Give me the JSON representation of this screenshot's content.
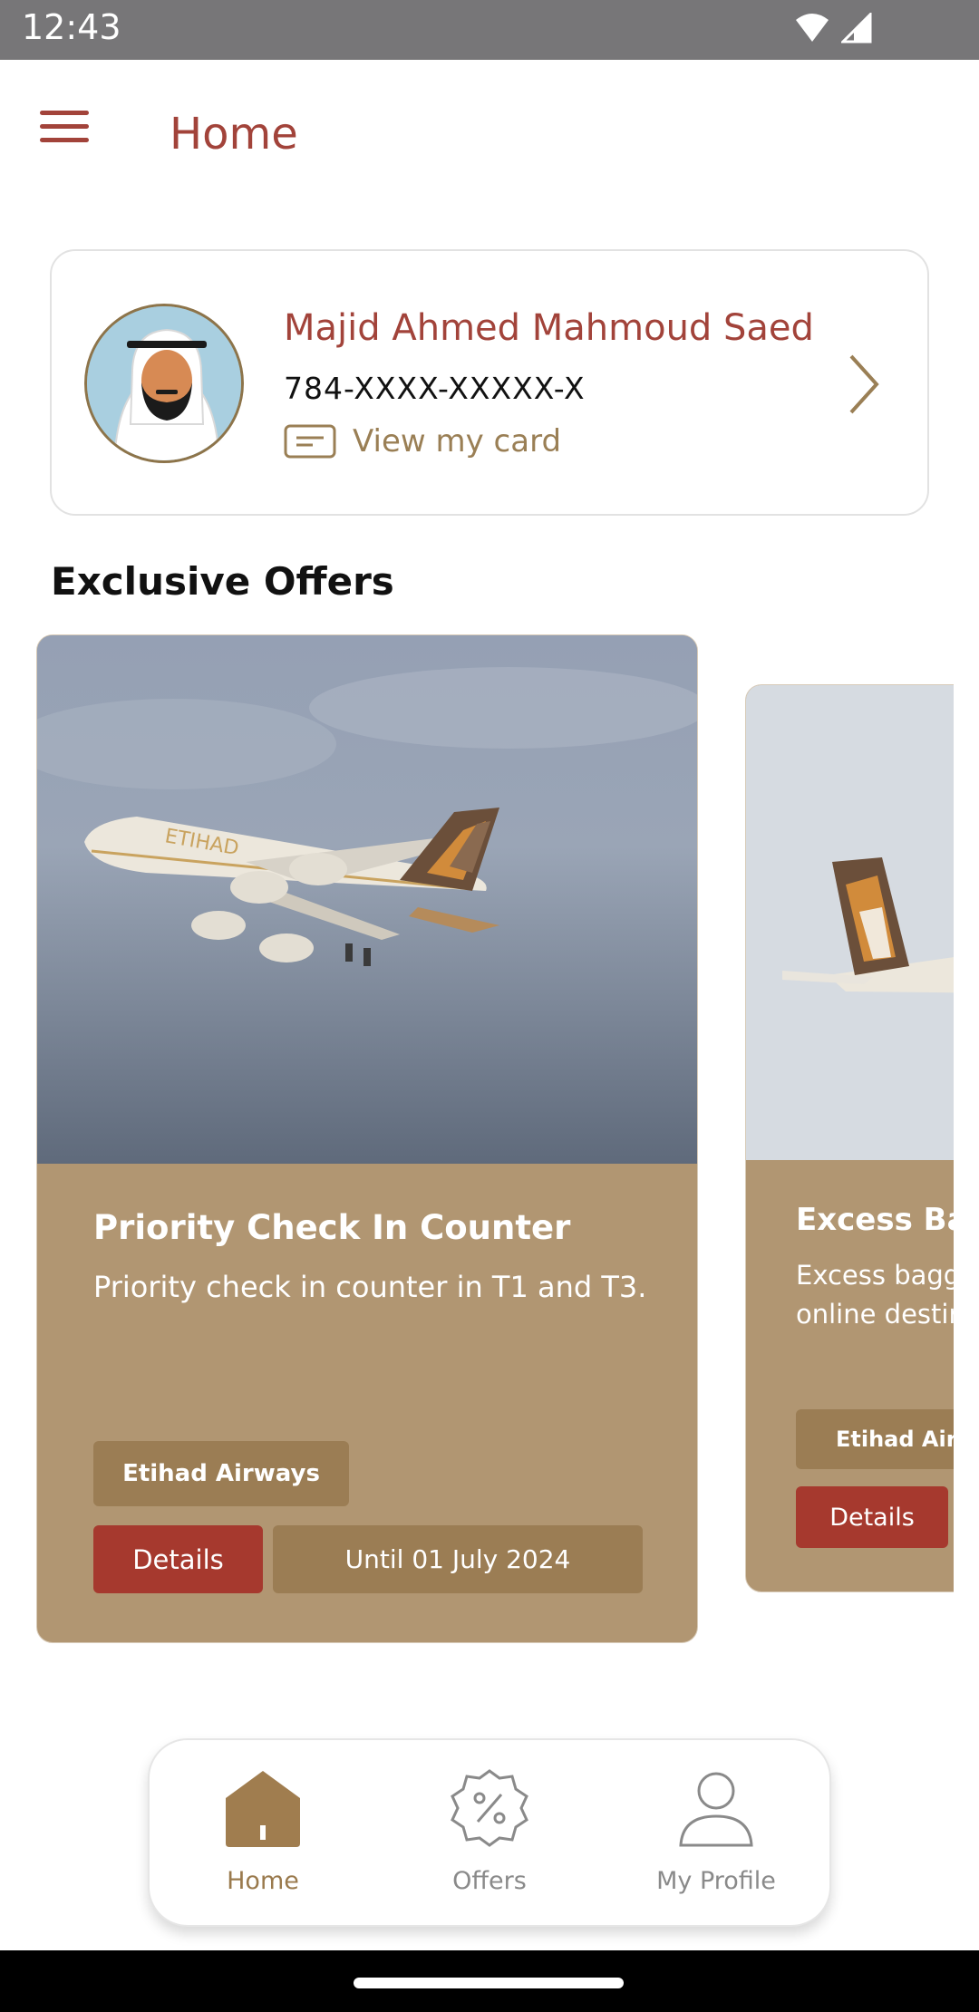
{
  "status_bar": {
    "time": "12:43"
  },
  "header": {
    "title": "Home"
  },
  "profile": {
    "name": "Majid Ahmed Mahmoud Saed",
    "id_number": "784-XXXX-XXXXX-X",
    "view_card_label": "View my card"
  },
  "offers_section": {
    "title": "Exclusive Offers"
  },
  "offers": [
    {
      "title": "Priority Check In Counter",
      "description": "Priority check in counter in T1 and T3.",
      "partner": "Etihad Airways",
      "details_label": "Details",
      "validity": "Until 01 July  2024"
    },
    {
      "title": "Excess Bagg",
      "description_line1": "Excess bagga",
      "description_line2": "online destina",
      "partner": "Etihad Airwa",
      "details_label": "Details"
    }
  ],
  "bottom_nav": {
    "items": [
      {
        "label": "Home",
        "icon": "home-icon",
        "active": true
      },
      {
        "label": "Offers",
        "icon": "offers-badge-icon",
        "active": false
      },
      {
        "label": "My Profile",
        "icon": "person-icon",
        "active": false
      }
    ]
  },
  "colors": {
    "brand_red": "#a2433a",
    "gold": "#9a7a4d",
    "card_tan": "#b19672"
  }
}
